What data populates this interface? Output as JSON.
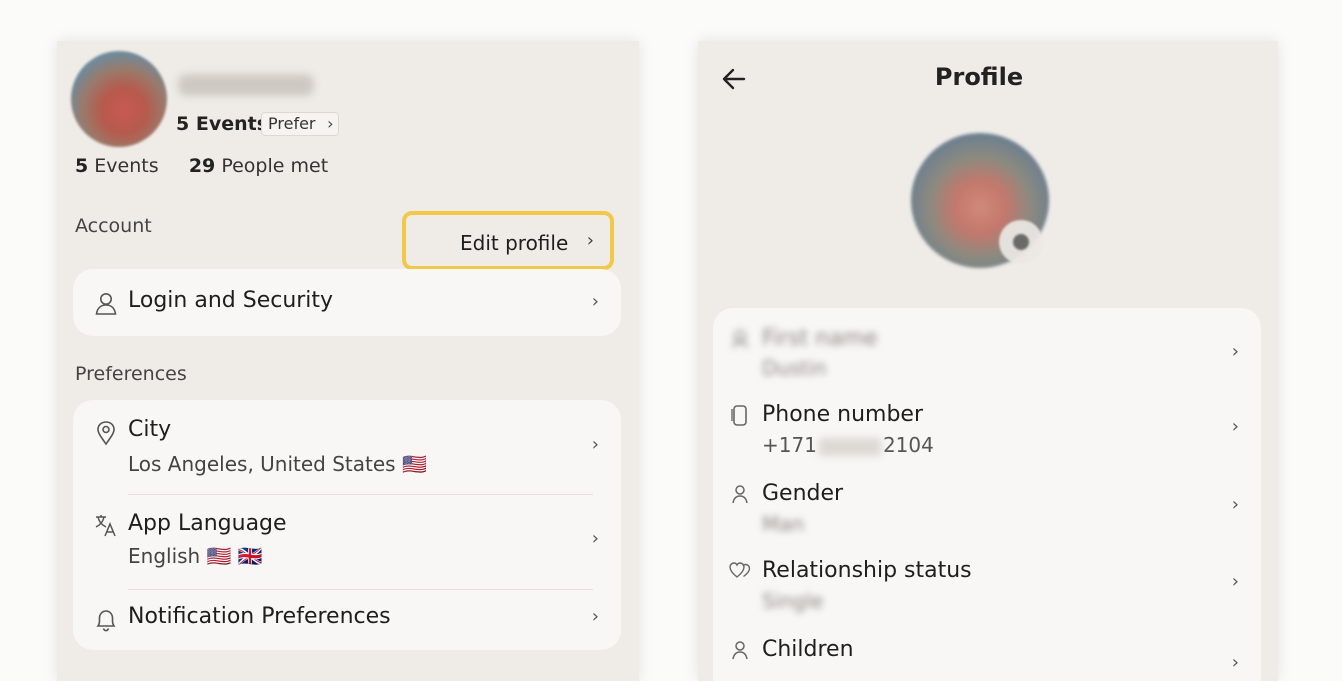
{
  "left": {
    "profile": {
      "name": "Rentpthrnote",
      "events_count": "5 Events",
      "prefer_label": "Prefer",
      "stats": [
        {
          "number": "5",
          "label": "Events"
        },
        {
          "number": "29",
          "label": "People met"
        }
      ]
    },
    "account_label": "Account",
    "edit_profile_label": "Edit profile",
    "account_rows": [
      {
        "title": "Login and Security",
        "icon": "user-icon"
      }
    ],
    "preferences_label": "Preferences",
    "preference_rows": [
      {
        "title": "City",
        "subtitle": "Los Angeles, United States 🇺🇸",
        "icon": "location-pin-icon"
      },
      {
        "title": "App Language",
        "subtitle": "English 🇺🇸 🇬🇧",
        "icon": "language-icon"
      },
      {
        "title": "Notification Preferences",
        "icon": "bell-icon"
      }
    ]
  },
  "right": {
    "title": "Profile",
    "fields": [
      {
        "title": "First name",
        "value": "Dustin",
        "blurred": true,
        "icon": "badge-icon"
      },
      {
        "title": "Phone number",
        "value_prefix": "+171",
        "value_suffix": "2104",
        "icon": "phone-icon"
      },
      {
        "title": "Gender",
        "value": "Man",
        "value_blurred": true,
        "icon": "person-icon"
      },
      {
        "title": "Relationship status",
        "value": "Single",
        "value_blurred": true,
        "icon": "hearts-icon"
      },
      {
        "title": "Children",
        "icon": "person-icon"
      }
    ]
  },
  "colors": {
    "highlight": "#f2c84b",
    "screen_bg": "#efece8",
    "card_bg": "#f8f7f5"
  }
}
